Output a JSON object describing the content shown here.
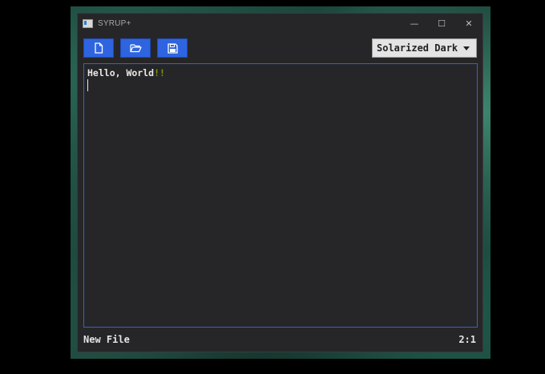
{
  "window": {
    "title": "SYRUP+",
    "controls": {
      "minimize": "—",
      "maximize": "☐",
      "close": "✕"
    }
  },
  "toolbar": {
    "buttons": [
      {
        "name": "new-file-button",
        "icon": "new-file-icon"
      },
      {
        "name": "open-folder-button",
        "icon": "folder-open-icon"
      },
      {
        "name": "save-button",
        "icon": "floppy-disk-icon"
      }
    ],
    "theme_select": {
      "selected": "Solarized Dark"
    }
  },
  "editor": {
    "text_main": "Hello, World",
    "text_punct": "!!"
  },
  "status": {
    "file_name": "New File",
    "cursor_position": "2:1"
  },
  "colors": {
    "accent": "#2f64e0",
    "editor_bg": "#262628",
    "punctuation": "#859900"
  }
}
